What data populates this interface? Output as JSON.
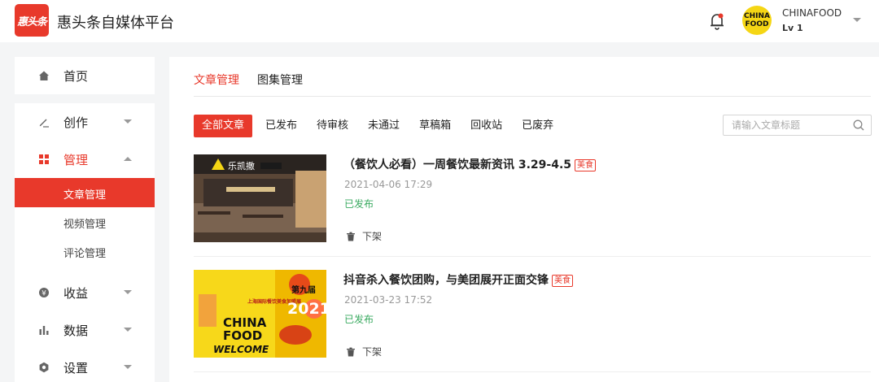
{
  "header": {
    "logo_text": "惠头条",
    "brand": "惠头条自媒体平台",
    "avatar_text_top": "CHINA",
    "avatar_text_bottom": "FOOD",
    "username": "CHINAFOOD",
    "level": "Lv 1"
  },
  "sidebar": {
    "home": "首页",
    "create": "创作",
    "manage": "管理",
    "sub": [
      "文章管理",
      "视频管理",
      "评论管理"
    ],
    "income": "收益",
    "data": "数据",
    "settings": "设置"
  },
  "main": {
    "tabs": [
      "文章管理",
      "图集管理"
    ],
    "filters": [
      "全部文章",
      "已发布",
      "待审核",
      "未通过",
      "草稿箱",
      "回收站",
      "已废弃"
    ],
    "search_placeholder": "请输入文章标题",
    "articles": [
      {
        "title": "（餐饮人必看）一周餐饮最新资讯 3.29-4.5",
        "tag": "美食",
        "date": "2021-04-06 17:29",
        "status": "已发布",
        "action": "下架",
        "thumb_sign": "乐凯撒"
      },
      {
        "title": "抖音杀入餐饮团购，与美团展开正面交锋",
        "tag": "美食",
        "date": "2021-03-23 17:52",
        "status": "已发布",
        "action": "下架",
        "thumb_text_1": "第九届",
        "thumb_text_2": "上海国际餐饮美食加盟展",
        "thumb_text_3": "CHINA",
        "thumb_text_4": "FOOD",
        "thumb_text_5": "WELCOME",
        "thumb_text_6": "2021"
      }
    ]
  },
  "colors": {
    "accent": "#e8392b",
    "published": "#3aaa60"
  }
}
